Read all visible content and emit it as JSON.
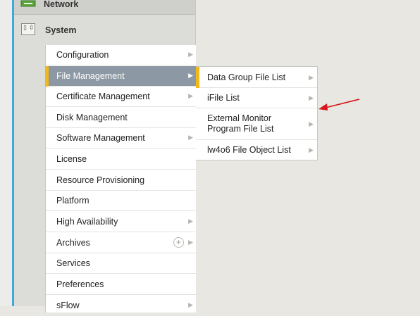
{
  "nav": {
    "network_label": "Network",
    "system_label": "System"
  },
  "menu": {
    "items": [
      {
        "label": "Configuration",
        "has_arrow": true
      },
      {
        "label": "File Management",
        "has_arrow": true,
        "active": true
      },
      {
        "label": "Certificate Management",
        "has_arrow": true
      },
      {
        "label": "Disk Management",
        "has_arrow": false
      },
      {
        "label": "Software Management",
        "has_arrow": true
      },
      {
        "label": "License",
        "has_arrow": false
      },
      {
        "label": "Resource Provisioning",
        "has_arrow": false
      },
      {
        "label": "Platform",
        "has_arrow": false
      },
      {
        "label": "High Availability",
        "has_arrow": true
      },
      {
        "label": "Archives",
        "has_arrow": true,
        "has_plus": true
      },
      {
        "label": "Services",
        "has_arrow": false
      },
      {
        "label": "Preferences",
        "has_arrow": false
      },
      {
        "label": "sFlow",
        "has_arrow": true
      }
    ]
  },
  "submenu": {
    "items": [
      {
        "label": "Data Group File List",
        "has_arrow": true,
        "active": true
      },
      {
        "label": "iFile List",
        "has_arrow": true
      },
      {
        "label": "External Monitor\nProgram File List",
        "has_arrow": true
      },
      {
        "label": "lw4o6 File Object List",
        "has_arrow": true
      }
    ]
  },
  "icons": {
    "network": "network-icon",
    "system": "system-icon",
    "chevron": "chevron-right-icon",
    "plus": "plus-circle-icon",
    "annotation": "red-arrow-annotation"
  },
  "colors": {
    "accent_blue": "#3fa9d9",
    "active_item_bg": "#8c98a3",
    "active_marker": "#f2b81b",
    "annotation_red": "#d9141b"
  }
}
